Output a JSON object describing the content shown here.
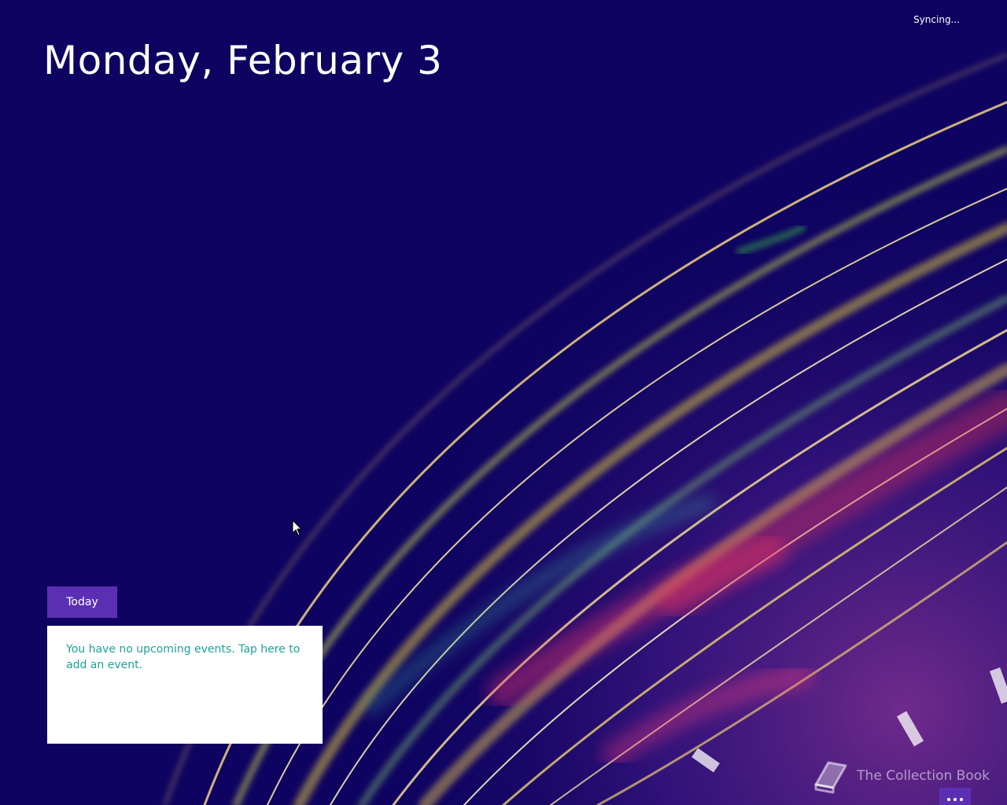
{
  "status": {
    "sync_text": "Syncing..."
  },
  "header": {
    "date_title": "Monday, February 3"
  },
  "agenda": {
    "today_label": "Today",
    "empty_message": "You have no upcoming events. Tap here to add an event."
  },
  "footer": {
    "watermark_text": "The Collection Book",
    "watermark_icon": "book-icon",
    "more_icon": "more-icon"
  },
  "colors": {
    "background": "#0e0360",
    "accent": "#5b2fb4",
    "event_text": "#1aa39b"
  }
}
